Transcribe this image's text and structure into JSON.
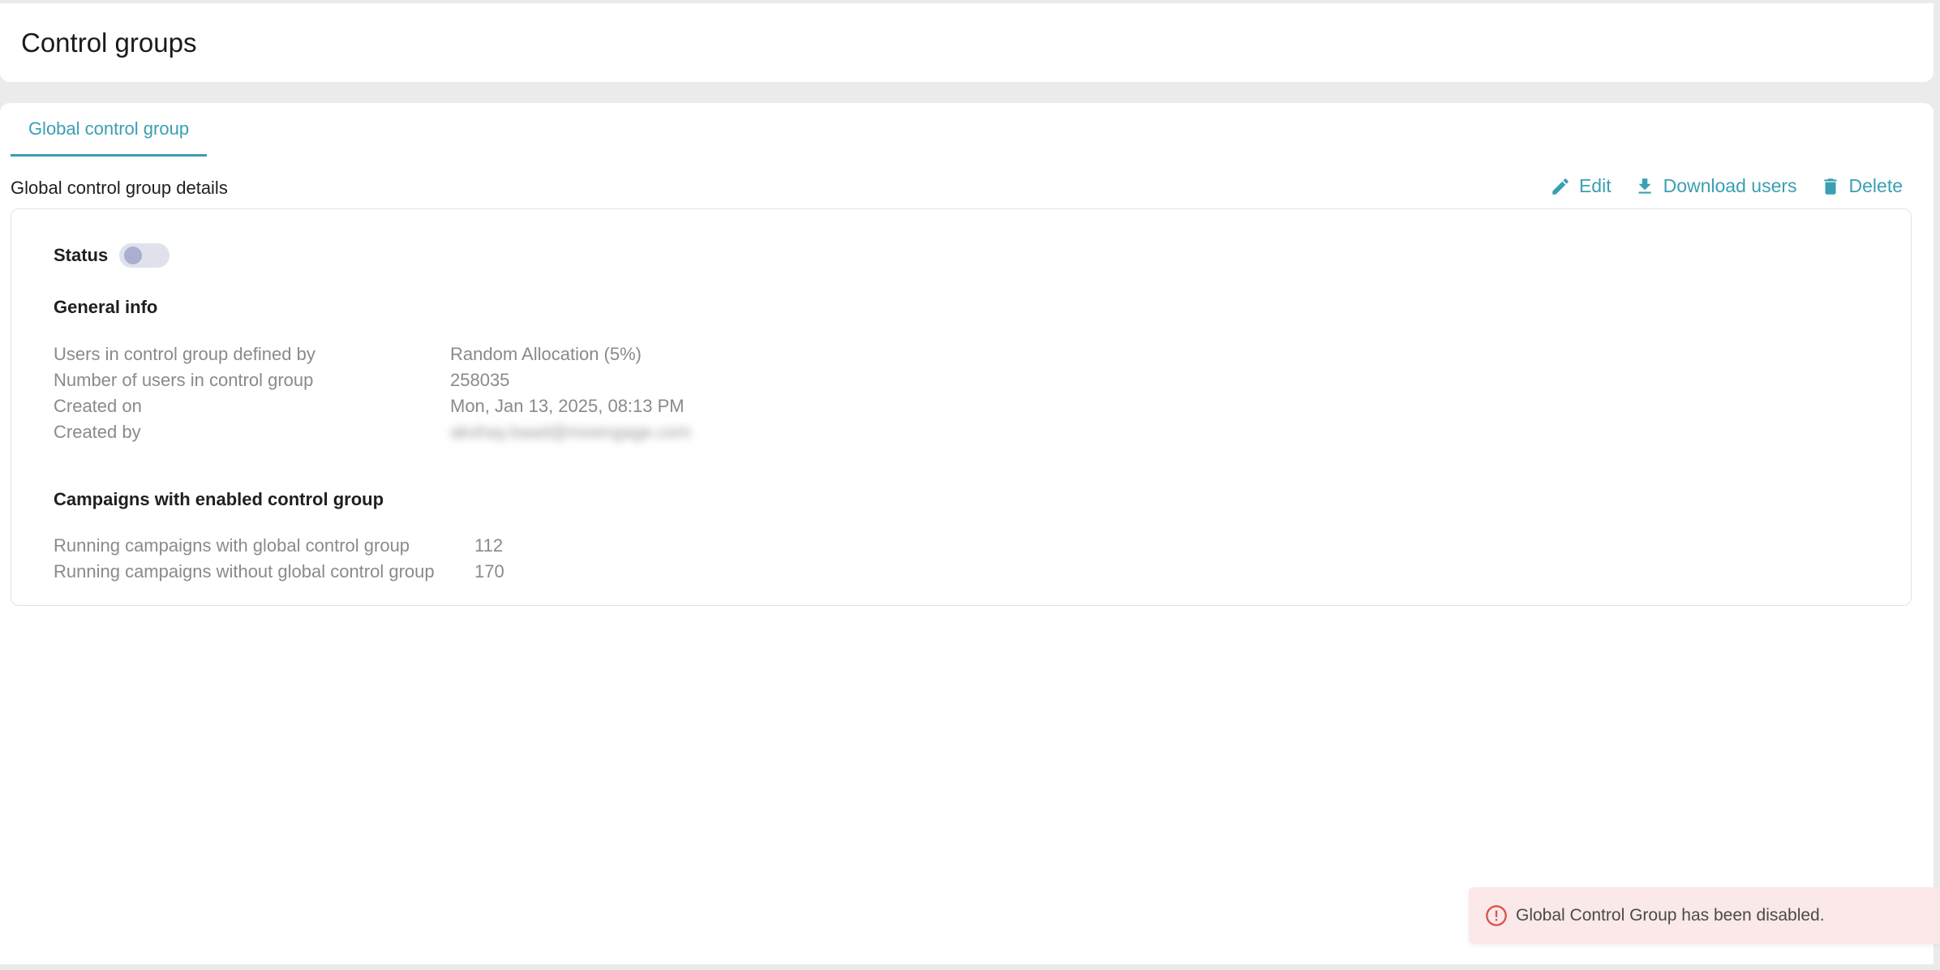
{
  "header": {
    "title": "Control groups"
  },
  "tabs": [
    {
      "label": "Global control group"
    }
  ],
  "details": {
    "title": "Global control group details",
    "actions": {
      "edit": "Edit",
      "download": "Download users",
      "delete": "Delete"
    }
  },
  "status": {
    "label": "Status",
    "enabled": false
  },
  "general_info": {
    "title": "General info",
    "rows": [
      {
        "label": "Users in control group defined by",
        "value": "Random Allocation (5%)"
      },
      {
        "label": "Number of users in control group",
        "value": "258035"
      },
      {
        "label": "Created on",
        "value": "Mon, Jan 13, 2025, 08:13 PM"
      },
      {
        "label": "Created by",
        "value": "akshay.baad@moengage.com"
      }
    ]
  },
  "campaigns": {
    "title": "Campaigns with enabled control group",
    "rows": [
      {
        "label": "Running campaigns with global control group",
        "value": "112"
      },
      {
        "label": "Running campaigns without global control group",
        "value": "170"
      }
    ]
  },
  "toast": {
    "message": "Global Control Group has been disabled."
  },
  "colors": {
    "accent": "#3a9fb2",
    "toast_bg": "#fbe8e8",
    "error": "#d9534f"
  }
}
